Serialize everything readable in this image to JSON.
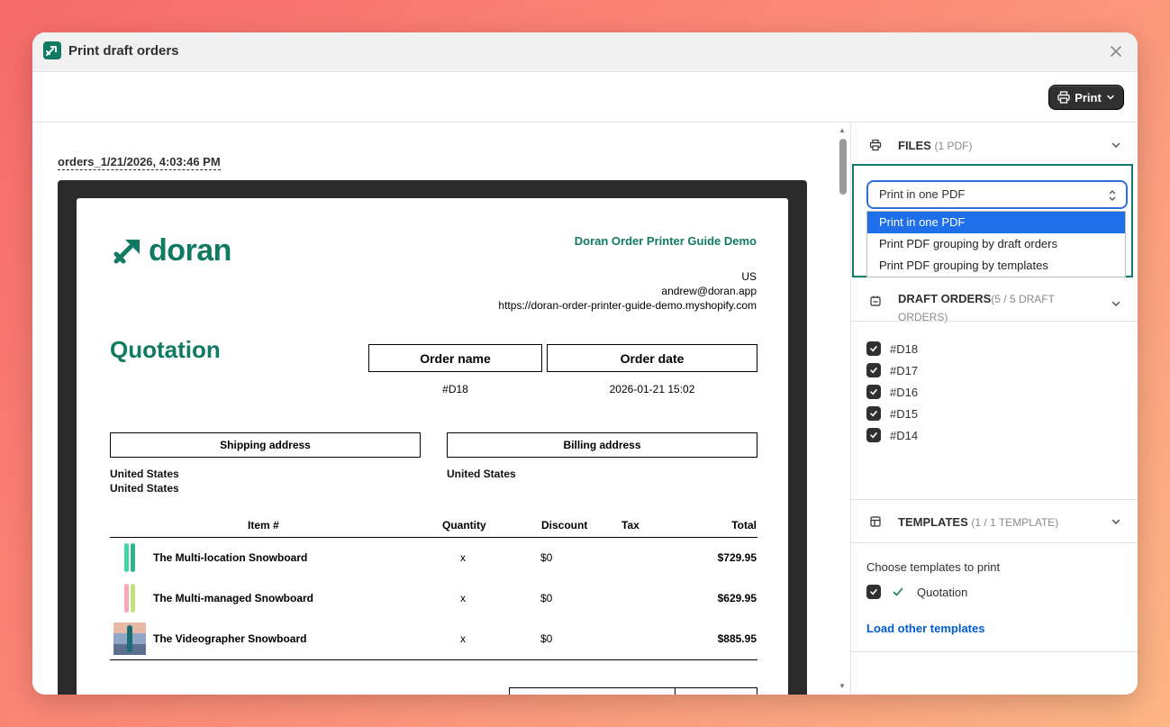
{
  "modal": {
    "title": "Print draft orders",
    "print_label": "Print"
  },
  "preview": {
    "file_name": "orders_1/21/2026, 4:03:46 PM",
    "doc": {
      "logo_text": "doran",
      "shop_name": "Doran Order Printer Guide Demo",
      "shop_lines": [
        "US",
        "andrew@doran.app",
        "https://doran-order-printer-guide-demo.myshopify.com"
      ],
      "title": "Quotation",
      "order_name_label": "Order name",
      "order_date_label": "Order date",
      "order_name": "#D18",
      "order_date": "2026-01-21 15:02",
      "shipping_label": "Shipping address",
      "billing_label": "Billing address",
      "shipping_lines": [
        "United States",
        "United States"
      ],
      "billing_lines": [
        "United States"
      ],
      "columns": [
        "Item #",
        "Quantity",
        "Discount",
        "Tax",
        "Total"
      ],
      "items": [
        {
          "name": "The Multi-location Snowboard",
          "quantity": "x",
          "discount": "$0",
          "tax": "",
          "total": "$729.95"
        },
        {
          "name": "The Multi-managed Snowboard",
          "quantity": "x",
          "discount": "$0",
          "tax": "",
          "total": "$629.95"
        },
        {
          "name": "The Videographer Snowboard",
          "quantity": "x",
          "discount": "$0",
          "tax": "",
          "total": "$885.95"
        }
      ]
    }
  },
  "sidebar": {
    "files": {
      "title": "FILES",
      "count": "(1 PDF)",
      "selected": "Print in one PDF",
      "options": [
        "Print in one PDF",
        "Print PDF grouping by draft orders",
        "Print PDF grouping by templates"
      ]
    },
    "draft_orders": {
      "title": "DRAFT ORDERS",
      "count_line1": "(5 / 5 DRAFT",
      "count_line2": "ORDERS)",
      "items": [
        "#D18",
        "#D17",
        "#D16",
        "#D15",
        "#D14"
      ]
    },
    "templates": {
      "title": "TEMPLATES",
      "count": "(1 / 1 TEMPLATE)",
      "choose_label": "Choose templates to print",
      "items": [
        "Quotation"
      ],
      "load_link": "Load other templates"
    }
  },
  "colors": {
    "brand_green": "#107a62",
    "highlight_border": "#0f7b6a",
    "select_blue": "#1f6feb",
    "link_blue": "#005bd3"
  }
}
